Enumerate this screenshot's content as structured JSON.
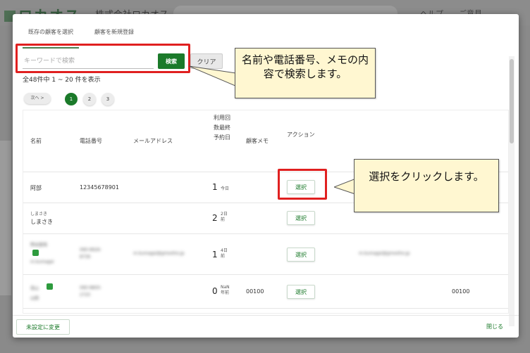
{
  "background": {
    "logo_text": "ロカオス",
    "company": "株式会社ロカオス",
    "right_text": "ヘルプ　　ご意見"
  },
  "tabs": [
    {
      "label": "既存の顧客を選択",
      "active": true
    },
    {
      "label": "顧客を新規登録",
      "active": false
    }
  ],
  "search": {
    "placeholder": "キーワードで検索",
    "search_label": "検索",
    "clear_label": "クリア"
  },
  "result_count": "全48件中 1 ~ 20 件を表示",
  "pager": {
    "next_label": "次へ >",
    "pages": [
      "1",
      "2",
      "3"
    ],
    "current": "1"
  },
  "table": {
    "headers": {
      "name": "名前",
      "phone": "電話番号",
      "email": "メールアドレス",
      "usage": "利用回数最終予約日",
      "memo": "顧客メモ",
      "action": "アクション"
    },
    "select_label": "選択",
    "rows": [
      {
        "kana": "",
        "name": "阿部",
        "phone": "12345678901",
        "email": "",
        "count": "1",
        "ago": "今日",
        "memo": "",
        "extra_email": "",
        "extra_memo": ""
      },
      {
        "kana": "しまさき",
        "name": "しまさき",
        "phone": "",
        "email": "",
        "count": "2",
        "ago": "2日前",
        "memo": "",
        "extra_email": "",
        "extra_memo": ""
      },
      {
        "kana": "熊谷直哉",
        "name": "m.kumagai",
        "phone": "090-9926-8736",
        "email": "m.kumagai@gmoshio.jp",
        "count": "1",
        "ago": "4日前",
        "memo": "",
        "extra_email": "m.kumagai@gmoshio.jp",
        "extra_memo": ""
      },
      {
        "kana": "見山",
        "name": "山田",
        "phone": "090-9800-2725",
        "email": "",
        "count": "0",
        "ago": "NaN年前",
        "memo": "00100",
        "extra_email": "",
        "extra_memo": "00100"
      }
    ]
  },
  "footer": {
    "unset_label": "未設定に変更",
    "close_label": "閉じる"
  },
  "callouts": {
    "search_note": "名前や電話番号、メモの内容で検索します。",
    "select_note": "選択をクリックします。"
  },
  "colors": {
    "primary": "#1b7a2a",
    "highlight": "#e02020",
    "callout_bg": "#fff7d1"
  }
}
